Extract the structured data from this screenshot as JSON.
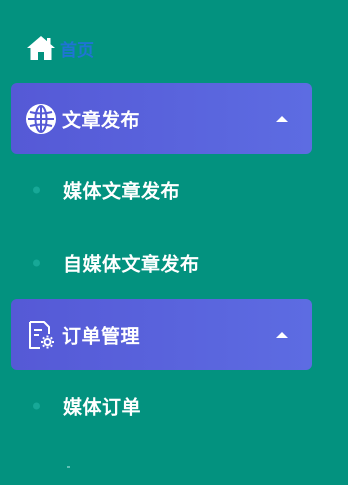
{
  "nav": {
    "home": {
      "label": "首页",
      "icon": "home-icon"
    },
    "groups": [
      {
        "label": "文章发布",
        "icon": "globe-icon",
        "expanded": true,
        "items": [
          {
            "label": "媒体文章发布"
          },
          {
            "label": "自媒体文章发布"
          }
        ]
      },
      {
        "label": "订单管理",
        "icon": "document-settings-icon",
        "expanded": true,
        "items": [
          {
            "label": "媒体订单"
          }
        ]
      }
    ]
  },
  "colors": {
    "background": "#03927f",
    "active_group": "#5559d6",
    "home_label": "#1f74d4",
    "sub_dot": "#17a897",
    "text": "#ffffff"
  }
}
